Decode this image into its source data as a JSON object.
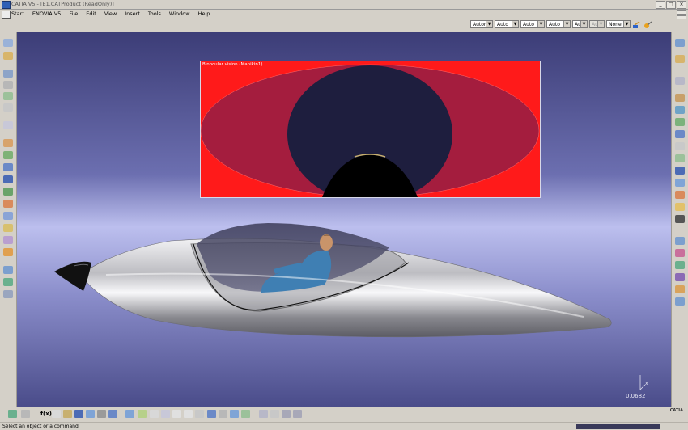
{
  "window": {
    "title": "CATIA V5 - [E1.CATProduct (ReadOnly)]"
  },
  "menu": {
    "items": [
      "Start",
      "ENOVIA V5",
      "File",
      "Edit",
      "View",
      "Insert",
      "Tools",
      "Window",
      "Help"
    ]
  },
  "toolbar": {
    "combos": [
      {
        "value": "Automa",
        "disabled": false
      },
      {
        "value": "Auto",
        "disabled": false
      },
      {
        "value": "Auto",
        "disabled": false
      },
      {
        "value": "Auto",
        "disabled": false
      },
      {
        "value": "Aut",
        "disabled": false
      },
      {
        "value": "Aut",
        "disabled": true
      },
      {
        "value": "None",
        "disabled": false
      }
    ]
  },
  "viewport": {
    "binocular_title": "Binocular vision (Manikin1)",
    "zoom_value": "0,0682",
    "axis_label": "x"
  },
  "bottom_toolbar": {
    "text_tool": "f(x)"
  },
  "status": {
    "text": "Select an object or a command"
  },
  "colors": {
    "background_top": "#3c3d77",
    "background_mid": "#bcbfee",
    "binocular_red": "#ff1a1a",
    "fuselage": "#c8c8cc"
  }
}
